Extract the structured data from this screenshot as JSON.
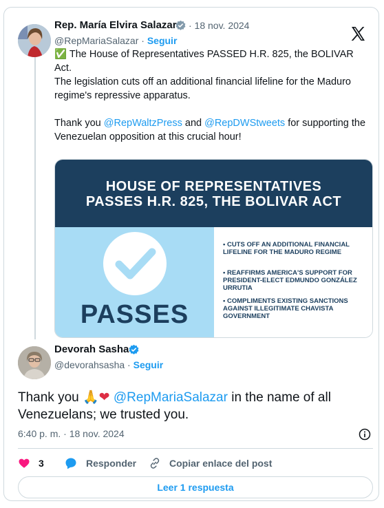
{
  "tweet": {
    "author_name": "Rep. María Elvira Salazar",
    "date": "· 18 nov. 2024",
    "handle": "@RepMariaSalazar",
    "follow_label": "Seguir",
    "line1": "The House of Representatives PASSED H.R. 825, the BOLIVAR Act.",
    "line2": "The legislation cuts off an additional financial lifeline for the Maduro regime's repressive apparatus.",
    "line3_prefix": "Thank you ",
    "mention1": "@RepWaltzPress",
    "line3_mid": " and ",
    "mention2": "@RepDWStweets",
    "line3_suffix": " for supporting the Venezuelan opposition at this crucial hour!",
    "check_emoji": "✅"
  },
  "infographic": {
    "headline_line1": "HOUSE OF REPRESENTATIVES",
    "headline_line2": "PASSES H.R. 825, THE BOLIVAR ACT",
    "passes_label": "PASSES",
    "bullets": [
      "• CUTS OFF AN ADDITIONAL FINANCIAL LIFELINE FOR THE MADURO REGIME",
      "• REAFFIRMS AMERICA'S SUPPORT FOR PRESIDENT-ELECT EDMUNDO GONZÁLEZ URRUTIA",
      "• COMPLIMENTS EXISTING SANCTIONS AGAINST ILLEGITIMATE CHAVISTA GOVERNMENT"
    ],
    "colors": {
      "navy": "#1c3f5e",
      "light_blue": "#a8dcf5"
    }
  },
  "reply": {
    "author_name": "Devorah Sasha",
    "handle": "@devorahsasha",
    "follow_label": "Seguir",
    "text_prefix": "Thank you ",
    "emojis": "🙏",
    "heart": "❤",
    "mention": "@RepMariaSalazar",
    "text_suffix": " in the name of all Venezuelans; we trusted you.",
    "timestamp": "6:40 p. m. · 18 nov. 2024"
  },
  "actions": {
    "like_count": "3",
    "reply_label": "Responder",
    "copy_label": "Copiar enlace del post",
    "read_replies_label": "Leer 1 respuesta"
  },
  "colors": {
    "accent": "#1d9bf0",
    "like": "#f91880",
    "text": "#0f1419",
    "secondary": "#536471"
  }
}
